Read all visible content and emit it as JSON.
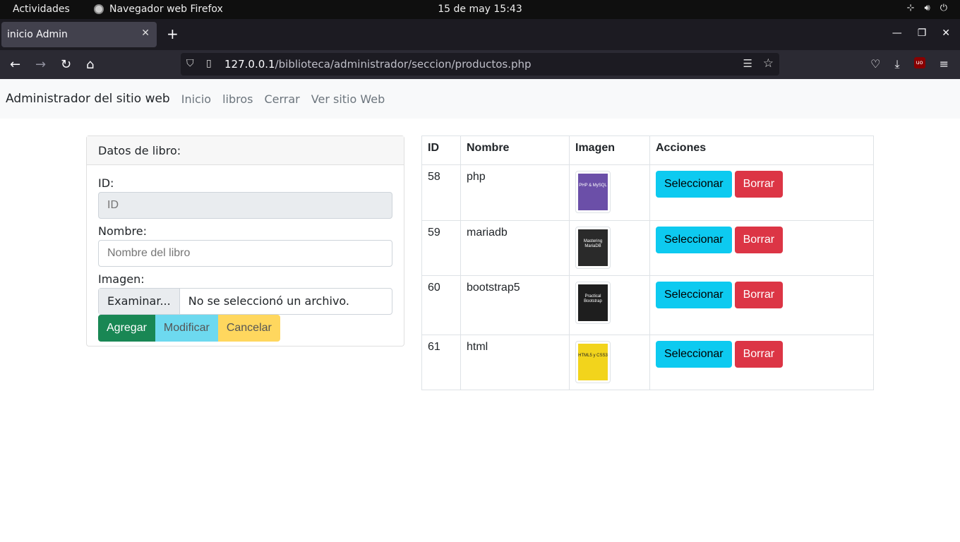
{
  "os": {
    "activities": "Actividades",
    "app_name": "Navegador web Firefox",
    "clock": "15 de may  15:43"
  },
  "browser": {
    "tab_title": "inicio Admin",
    "url_host": "127.0.0.1",
    "url_path": "/biblioteca/administrador/seccion/productos.php",
    "ublock_label": "uo"
  },
  "site_nav": {
    "brand": "Administrador del sitio web",
    "links": [
      "Inicio",
      "libros",
      "Cerrar",
      "Ver sitio Web"
    ]
  },
  "form": {
    "header": "Datos de libro:",
    "id_label": "ID:",
    "id_placeholder": "ID",
    "name_label": "Nombre:",
    "name_placeholder": "Nombre del libro",
    "image_label": "Imagen:",
    "browse_label": "Examinar...",
    "no_file": "No se seleccionó un archivo.",
    "add_label": "Agregar",
    "modify_label": "Modificar",
    "cancel_label": "Cancelar"
  },
  "table": {
    "headers": [
      "ID",
      "Nombre",
      "Imagen",
      "Acciones"
    ],
    "select_label": "Seleccionar",
    "delete_label": "Borrar",
    "rows": [
      {
        "id": "58",
        "name": "php",
        "cover_text": "PHP & MySQL",
        "cover_color": "#6b4fa8"
      },
      {
        "id": "59",
        "name": "mariadb",
        "cover_text": "Mastering MariaDB",
        "cover_color": "#2a2a2a"
      },
      {
        "id": "60",
        "name": "bootstrap5",
        "cover_text": "Practical Bootstrap",
        "cover_color": "#1e1e1e"
      },
      {
        "id": "61",
        "name": "html",
        "cover_text": "HTML5 y CSS3",
        "cover_color": "#f2d41c"
      }
    ]
  }
}
